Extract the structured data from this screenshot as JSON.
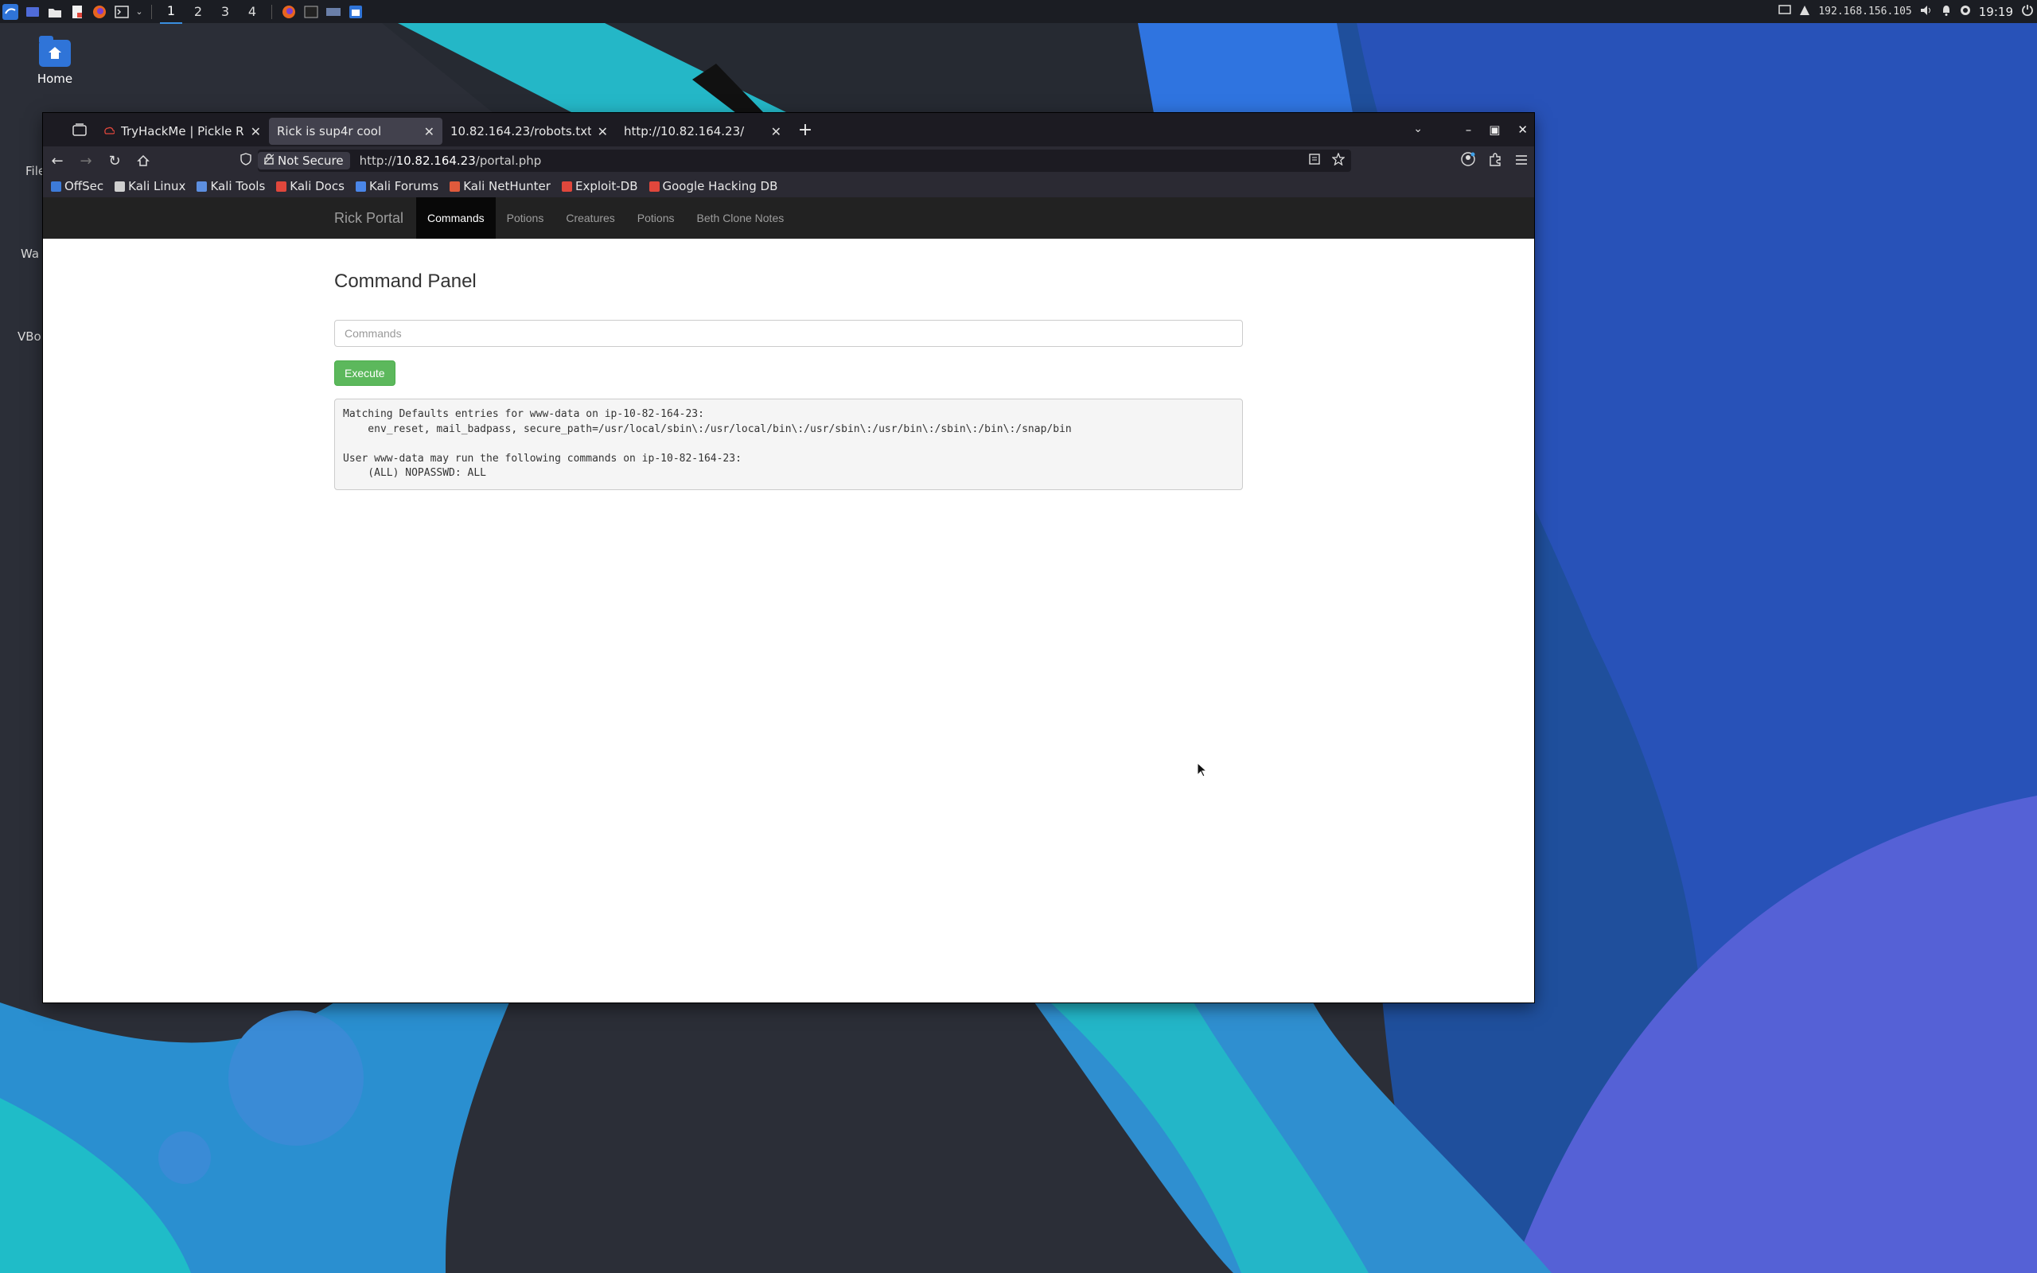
{
  "taskbar": {
    "workspaces": [
      "1",
      "2",
      "3",
      "4"
    ],
    "active_workspace": "1",
    "ip": "192.168.156.105",
    "clock": "19:19"
  },
  "desktop": {
    "home_label": "Home",
    "partial_labels": [
      "File",
      "Wa",
      "VBo"
    ]
  },
  "browser": {
    "tabs": [
      {
        "title": "TryHackMe | Pickle Rick",
        "active": false
      },
      {
        "title": "Rick is sup4r cool",
        "active": true
      },
      {
        "title": "10.82.164.23/robots.txt",
        "active": false
      },
      {
        "title": "http://10.82.164.23/",
        "active": false
      }
    ],
    "security_label": "Not Secure",
    "url_prefix": "http://",
    "url_host": "10.82.164.23",
    "url_path": "/portal.php",
    "bookmarks": [
      {
        "label": "OffSec",
        "color": "#3d7bd9"
      },
      {
        "label": "Kali Linux",
        "color": "#cfcfcf"
      },
      {
        "label": "Kali Tools",
        "color": "#5d8fe0"
      },
      {
        "label": "Kali Docs",
        "color": "#e0473c"
      },
      {
        "label": "Kali Forums",
        "color": "#4a86e8"
      },
      {
        "label": "Kali NetHunter",
        "color": "#e05a3c"
      },
      {
        "label": "Exploit-DB",
        "color": "#e0473c"
      },
      {
        "label": "Google Hacking DB",
        "color": "#e0473c"
      }
    ]
  },
  "site": {
    "brand": "Rick Portal",
    "nav": [
      {
        "label": "Commands",
        "active": true
      },
      {
        "label": "Potions",
        "active": false
      },
      {
        "label": "Creatures",
        "active": false
      },
      {
        "label": "Potions",
        "active": false
      },
      {
        "label": "Beth Clone Notes",
        "active": false
      }
    ],
    "heading": "Command Panel",
    "input_placeholder": "Commands",
    "input_value": "",
    "execute_label": "Execute",
    "output": "Matching Defaults entries for www-data on ip-10-82-164-23:\n    env_reset, mail_badpass, secure_path=/usr/local/sbin\\:/usr/local/bin\\:/usr/sbin\\:/usr/bin\\:/sbin\\:/bin\\:/snap/bin\n\nUser www-data may run the following commands on ip-10-82-164-23:\n    (ALL) NOPASSWD: ALL"
  }
}
